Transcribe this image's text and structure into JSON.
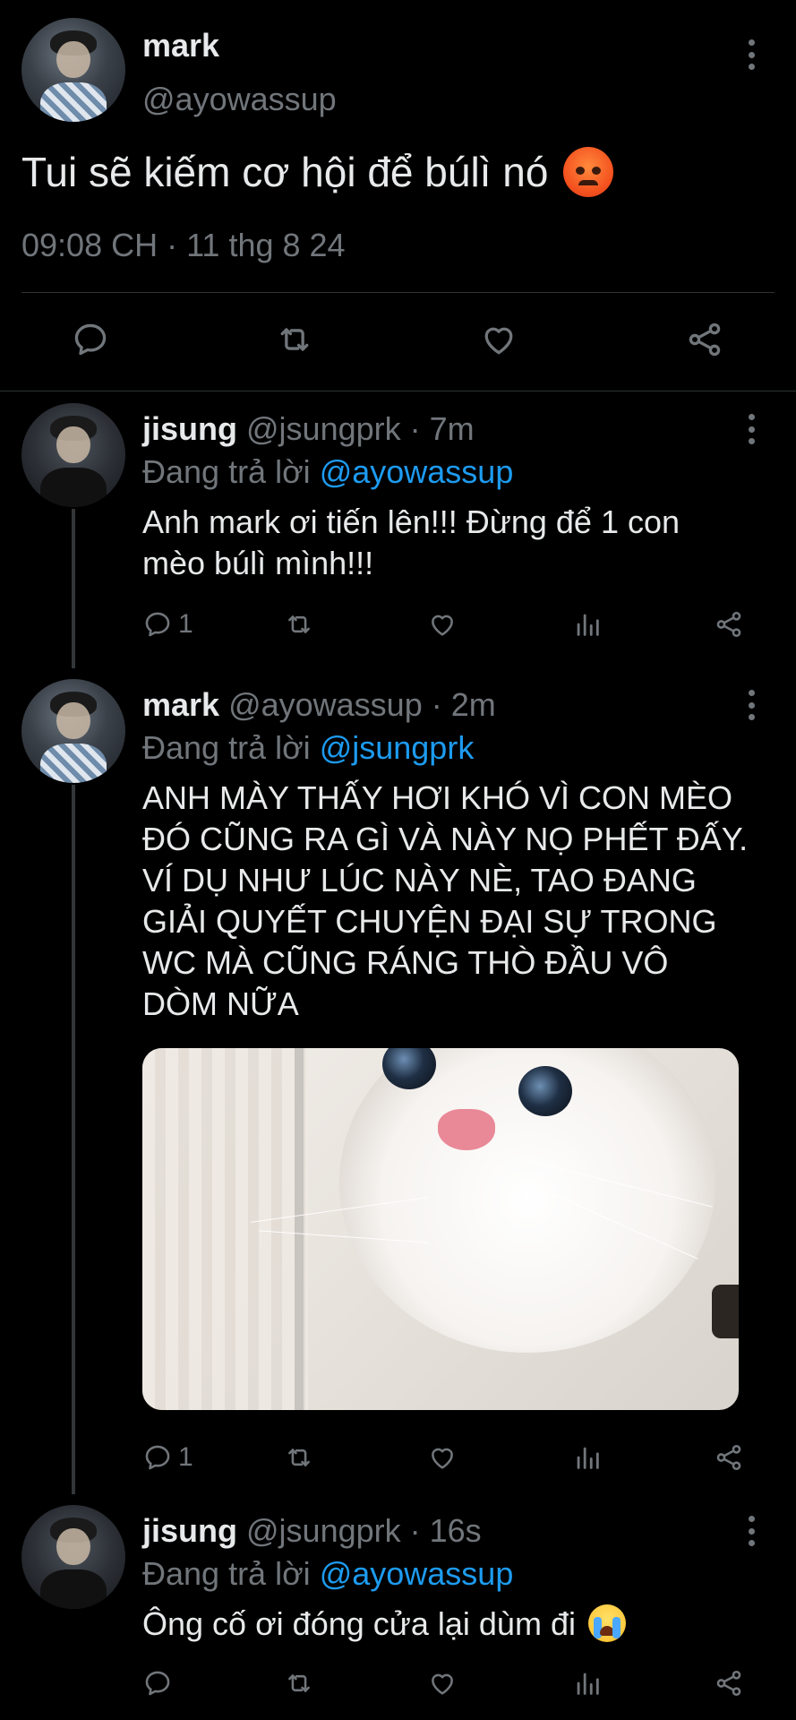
{
  "main_tweet": {
    "author_name": "mark",
    "author_handle": "@ayowassup",
    "text": "Tui sẽ kiếm cơ hội để búlì nó",
    "emoji": "angry-face",
    "timestamp": "09:08 CH · 11 thg 8 24",
    "actions": [
      "reply-icon",
      "retweet-icon",
      "like-icon",
      "share-icon"
    ]
  },
  "replies": [
    {
      "author_name": "jisung",
      "meta": "@jsungprk · 7m",
      "replying_prefix": "Đang trả lời",
      "replying_to": "@ayowassup",
      "text_lines": [
        "Anh mark ơi tiến lên!!! Đừng để 1 con",
        "mèo búlì mình!!!"
      ],
      "reply_count": "1"
    },
    {
      "author_name": "mark",
      "meta": "@ayowassup · 2m",
      "replying_prefix": "Đang trả lời",
      "replying_to": "@jsungprk",
      "text_lines": [
        "ANH MÀY THẤY HƠI KHÓ VÌ CON MÈO",
        "ĐÓ CŨNG RA GÌ VÀ NÀY NỌ PHẾT ĐẤY.",
        "VÍ DỤ NHƯ LÚC NÀY NÈ, TAO ĐANG",
        "GIẢI QUYẾT CHUYỆN ĐẠI SỰ TRONG",
        "WC MÀ CŨNG RÁNG THÒ ĐẦU VÔ",
        "DÒM NỮA"
      ],
      "media": "cat-photo",
      "reply_count": "1"
    },
    {
      "author_name": "jisung",
      "meta": "@jsungprk · 16s",
      "replying_prefix": "Đang trả lời",
      "replying_to": "@ayowassup",
      "text": "Ông cố ơi đóng cửa lại dùm đi",
      "emoji": "crying-face",
      "reply_count": ""
    }
  ],
  "colors": {
    "background": "#000000",
    "text": "#e7e9ea",
    "secondary": "#71767b",
    "link": "#1d9bf0",
    "divider": "#2f3336"
  }
}
